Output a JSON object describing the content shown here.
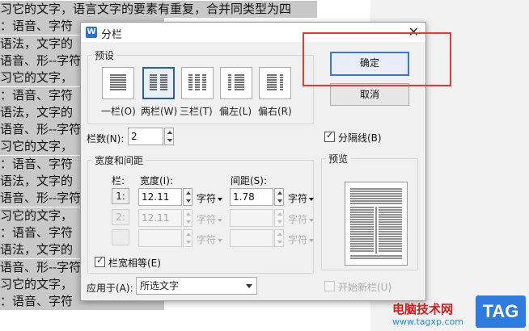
{
  "document": {
    "lines": [
      "习它的文字，语言文字的要素有重复，合并同类型为四",
      "：语音、字符",
      "语法，文字的",
      "语音、形--字符",
      "习它的文字，",
      "：语音、字符",
      "语法，文字的",
      "语音、形--字符",
      "习它的文字，",
      "：语音、字符",
      "语法，文字的",
      "语音、形--字符",
      "习它的文字，",
      "：语音、字符",
      "语法，文字的",
      "语音、形--字符",
      "习它的文字，",
      "：语音、字符"
    ]
  },
  "dialog": {
    "app_icon": "W",
    "title": "分栏",
    "preset_group": "预设",
    "presets": [
      {
        "label": "一栏(O)",
        "columns": 1,
        "selected": false
      },
      {
        "label": "两栏(W)",
        "columns": 2,
        "selected": true
      },
      {
        "label": "三栏(T)",
        "columns": 3,
        "selected": false
      },
      {
        "label": "偏左(L)",
        "columns": "left",
        "selected": false
      },
      {
        "label": "偏右(R)",
        "columns": "right",
        "selected": false
      }
    ],
    "ok_label": "确定",
    "cancel_label": "取消",
    "column_count_label": "栏数(N):",
    "column_count_value": "2",
    "separator_label": "分隔线(B)",
    "separator_checked": true,
    "width_spacing_group": "宽度和间距",
    "col_header": "栏:",
    "width_header": "宽度(I):",
    "spacing_header": "间距(S):",
    "rows": [
      {
        "num": "1:",
        "width": "12.11",
        "width_unit": "字符",
        "spacing": "1.78",
        "spacing_unit": "字符",
        "enabled": true
      },
      {
        "num": "2:",
        "width": "12.11",
        "width_unit": "字符",
        "spacing": "",
        "spacing_unit": "字符",
        "enabled": false
      },
      {
        "num": "",
        "width": "",
        "width_unit": "字符",
        "spacing": "",
        "spacing_unit": "字符",
        "enabled": false
      }
    ],
    "equal_width_label": "栏宽相等(E)",
    "equal_width_checked": true,
    "preview_group": "预览",
    "apply_to_label": "应用于(A):",
    "apply_to_value": "所选文字",
    "new_column_label": "开始新栏(U)",
    "new_column_checked": false
  },
  "watermark": {
    "site_name": "电脑技术网",
    "url": "www.tagxp.com",
    "logo": "TAG"
  },
  "colors": {
    "selection": "#c8c8c8",
    "dialog_bg": "#f0f0f0",
    "highlight": "#e53935",
    "accent": "#2b5fa8"
  }
}
